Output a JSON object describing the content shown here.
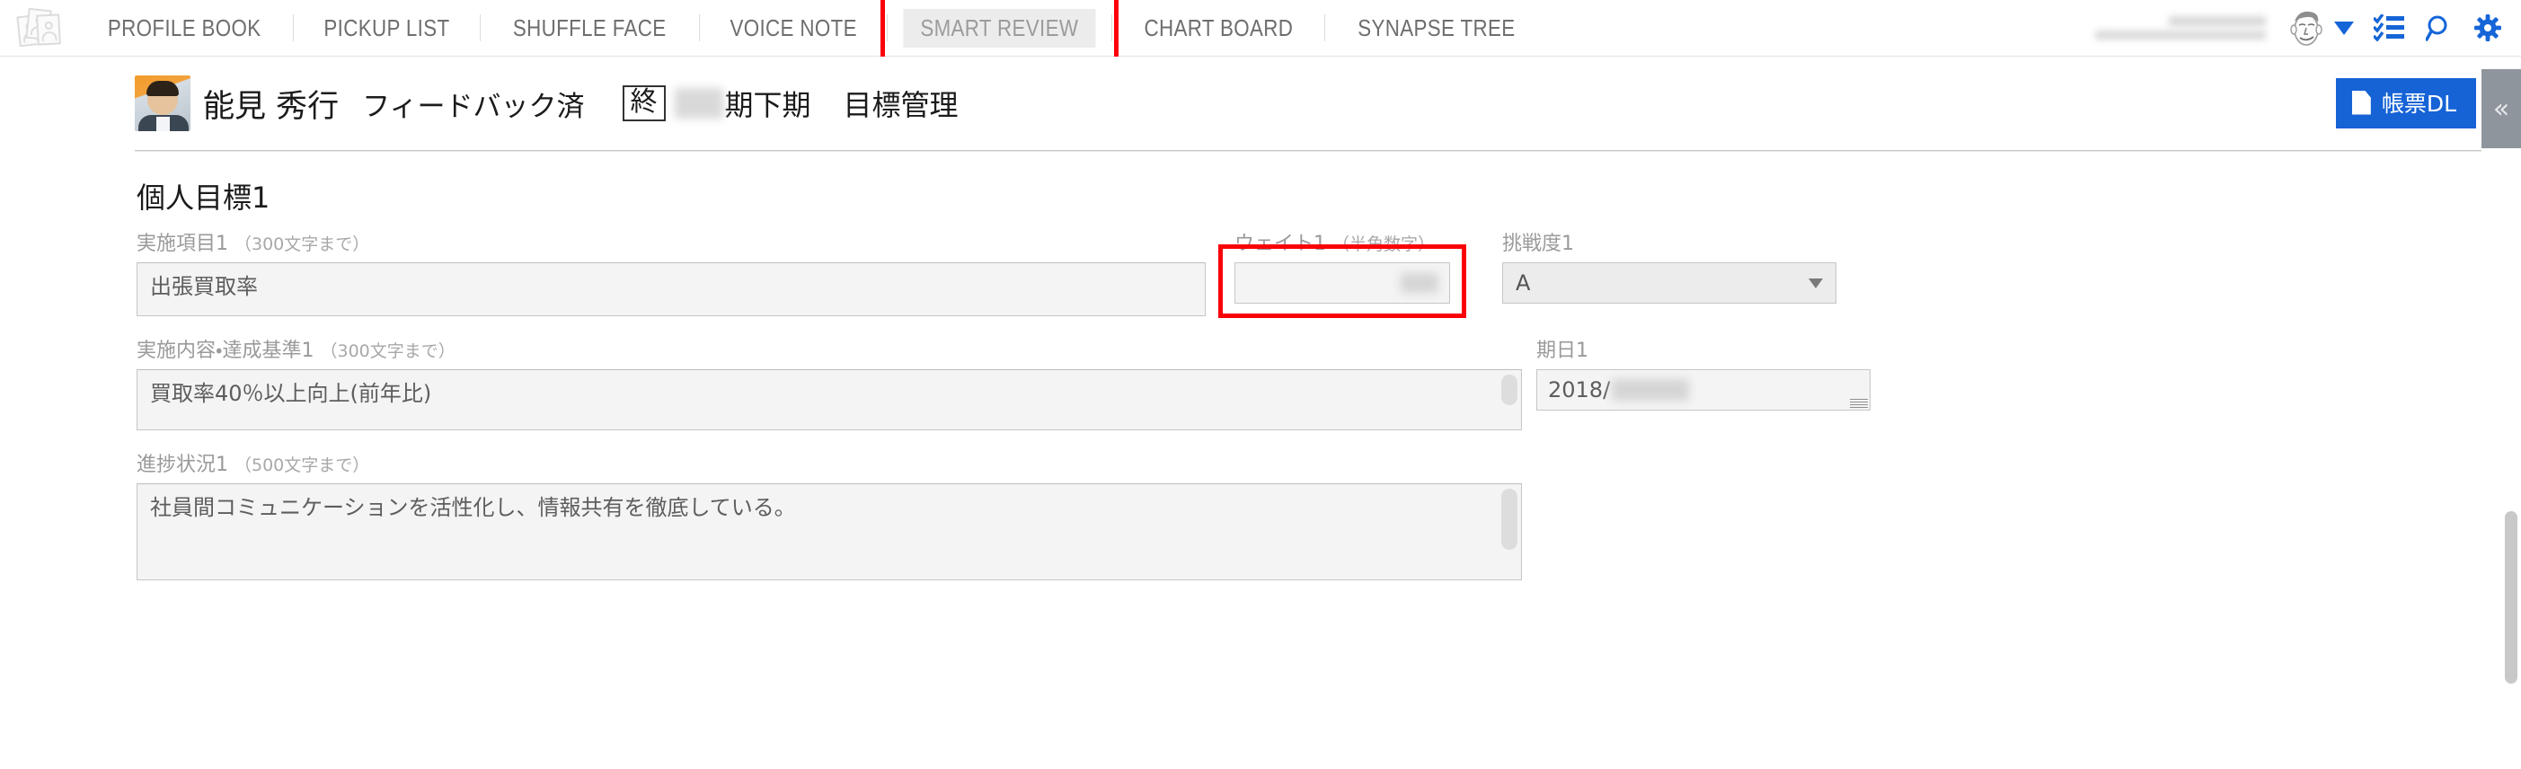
{
  "nav": {
    "logo_label": "photo-cards-logo",
    "items": [
      {
        "label": "PROFILE BOOK",
        "active": false
      },
      {
        "label": "PICKUP LIST",
        "active": false
      },
      {
        "label": "SHUFFLE FACE",
        "active": false
      },
      {
        "label": "VOICE NOTE",
        "active": false
      },
      {
        "label": "SMART REVIEW",
        "active": true
      },
      {
        "label": "CHART BOARD",
        "active": false
      },
      {
        "label": "SYNAPSE TREE",
        "active": false
      }
    ],
    "user": {
      "line1": "",
      "line2": ""
    },
    "icons": {
      "avatar": "user-avatar-icon",
      "caret": "chevron-down-icon",
      "checklist": "checklist-icon",
      "search": "search-icon",
      "settings": "gear-icon"
    }
  },
  "header": {
    "employee_name": "能見 秀行",
    "status": "フィードバック済",
    "term_badge": "終",
    "term_masked": "",
    "term_text": "期下期",
    "doc_title": "目標管理",
    "download_label": "帳票DL",
    "collapse_label": "«"
  },
  "main": {
    "section_title": "個人目標1",
    "fields": {
      "item1": {
        "label": "実施項目1",
        "hint": "（300文字まで）",
        "value": "出張買取率"
      },
      "weight1": {
        "label": "ウェイト1",
        "hint": "（半角数字）",
        "value": ""
      },
      "challenge1": {
        "label": "挑戦度1",
        "hint": "",
        "value": "A"
      },
      "criteria1": {
        "label": "実施内容・達成基準1",
        "hint": "（300文字まで）",
        "value": "買取率40％以上向上(前年比)"
      },
      "duedate1": {
        "label": "期日1",
        "hint": "",
        "value": "2018/"
      },
      "progress1": {
        "label": "進捗状況1",
        "hint": "（500文字まで）",
        "value": "社員間コミュニケーションを活性化し、情報共有を徹底している。"
      }
    }
  },
  "colors": {
    "accent_blue": "#1663d6",
    "annotation_red": "#fb0007",
    "nav_active_bg": "#ececec",
    "field_bg": "#f4f4f4"
  }
}
